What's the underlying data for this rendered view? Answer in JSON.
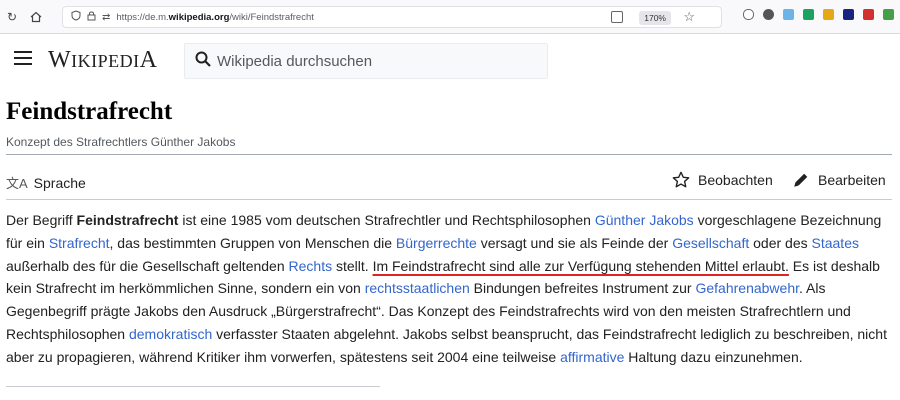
{
  "browser": {
    "url_prefix": "https://de.m.",
    "url_domain": "wikipedia.org",
    "url_path": "/wiki/Feindstrafrecht",
    "zoom": "170%"
  },
  "header": {
    "wordmark_first": "W",
    "wordmark_rest": "IKIPEDI",
    "wordmark_last": "A",
    "search_placeholder": "Wikipedia durchsuchen"
  },
  "page": {
    "title": "Feindstrafrecht",
    "subtitle": "Konzept des Strafrechtlers Günther Jakobs",
    "language_label": "Sprache",
    "watch_label": "Beobachten",
    "edit_label": "Bearbeiten"
  },
  "article": {
    "p1": "Der Begriff ",
    "b1": "Feindstrafrecht",
    "p2": " ist eine 1985 vom deutschen Strafrechtler und Rechtsphilosophen ",
    "l1": "Günther Jakobs",
    "p3": " vorgeschlagene Bezeichnung für ein ",
    "l2": "Strafrecht",
    "p4": ", das bestimmten Gruppen von Menschen die ",
    "l3": "Bürgerrechte",
    "p5": " versagt und sie als Feinde der ",
    "l4": "Gesellschaft",
    "p6": " oder des ",
    "l5": "Staates",
    "p7": " außerhalb des für die Gesellschaft geltenden ",
    "l6": "Rechts",
    "p8": " stellt. ",
    "u1": "Im Feindstrafrecht sind alle zur Verfügung stehenden Mittel erlaubt.",
    "p9": " Es ist deshalb kein Strafrecht im herkömmlichen Sinne, sondern ein von ",
    "l7": "rechtsstaatlichen",
    "p10": " Bindungen befreites Instrument zur ",
    "l8": "Gefahrenabwehr",
    "p11": ". Als Gegenbegriff prägte Jakobs den Ausdruck „Bürgerstrafrecht“. Das Konzept des Feindstrafrechts wird von den meisten Strafrechtlern und Rechtsphilosophen ",
    "l9": "demokratisch",
    "p12": " verfasster Staaten abgelehnt. Jakobs selbst beansprucht, das Feindstrafrecht lediglich zu beschreiben, nicht aber zu propagieren, während Kritiker ihm vorwerfen, spätestens seit 2004 eine teilweise ",
    "l10": "affirmative",
    "p13": " Haltung dazu einzunehmen."
  },
  "icons": {
    "back": "back-arrow-icon",
    "home": "home-icon",
    "shield": "shield-icon",
    "lock": "lock-icon",
    "reader": "reader-view-icon",
    "bookmark": "star-icon",
    "menu": "hamburger-menu-icon",
    "search": "search-icon",
    "language": "translate-icon",
    "watch": "star-outline-icon",
    "edit": "pencil-icon"
  },
  "colors": {
    "link": "#3366cc",
    "underline_highlight": "#e02424",
    "text": "#202122"
  }
}
